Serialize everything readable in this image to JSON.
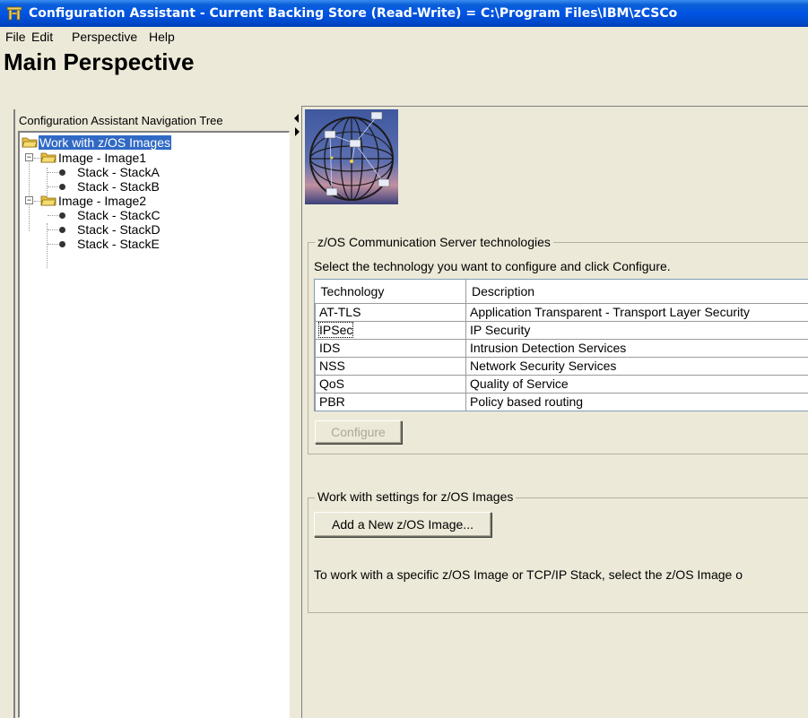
{
  "window": {
    "title": "Configuration Assistant - Current Backing Store (Read-Write) = C:\\Program Files\\IBM\\zCSCo"
  },
  "menu": {
    "items": [
      "File",
      "Edit",
      "Perspective",
      "Help"
    ]
  },
  "perspective_title": "Main Perspective",
  "navigation": {
    "header": "Configuration Assistant Navigation Tree",
    "root": "Work with z/OS Images",
    "images": [
      {
        "label": "Image - Image1",
        "stacks": [
          "Stack - StackA",
          "Stack - StackB"
        ]
      },
      {
        "label": "Image - Image2",
        "stacks": [
          "Stack - StackC",
          "Stack - StackD",
          "Stack - StackE"
        ]
      }
    ]
  },
  "technologies": {
    "group_title": "z/OS Communication Server technologies",
    "instructions": "Select the  technology you want to configure and click Configure.",
    "columns": [
      "Technology",
      "Description"
    ],
    "rows": [
      [
        "AT-TLS",
        "Application Transparent - Transport Layer Security"
      ],
      [
        "IPSec",
        "IP Security"
      ],
      [
        "IDS",
        "Intrusion Detection Services"
      ],
      [
        "NSS",
        "Network Security Services"
      ],
      [
        "QoS",
        "Quality of Service"
      ],
      [
        "PBR",
        "Policy based routing"
      ]
    ],
    "configure_button": "Configure"
  },
  "settings": {
    "group_title": "Work with settings for z/OS Images",
    "add_button": "Add a New z/OS Image...",
    "help_text": "To work with a specific z/OS Image or TCP/IP Stack, select the z/OS Image o"
  },
  "colors": {
    "title_bar": "#0054e3",
    "selection": "#316ac5",
    "window_bg": "#ece9d8"
  }
}
